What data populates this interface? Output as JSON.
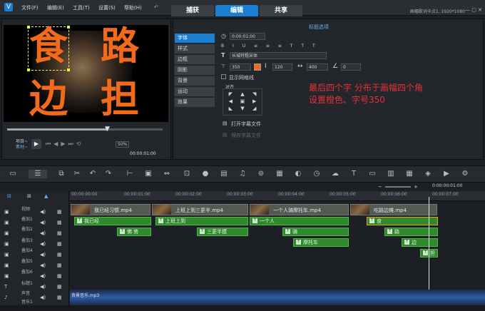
{
  "menu": {
    "file": "文件(F)",
    "edit": "编辑(E)",
    "tools": "工具(T)",
    "settings": "设置(S)",
    "help": "帮助(H)"
  },
  "tabs": {
    "capture": "捕获",
    "edit": "编辑",
    "share": "共享"
  },
  "window_info": "画幅歌词卡点1, 1920*1080",
  "preview": {
    "chars": [
      "食",
      "路",
      "边",
      "担"
    ],
    "project_label": "项目~",
    "clip_label": "素材~",
    "zoom": "50%",
    "timecode": "00:00:01:00"
  },
  "side_tabs": [
    "字体",
    "样式",
    "边框",
    "阴影",
    "背景",
    "运动",
    "效果"
  ],
  "options": {
    "title": "标题选项",
    "duration": "0:00:01:00",
    "format_buttons": [
      "B",
      "I",
      "U",
      "≡",
      "≡",
      "≡",
      "T",
      "T",
      "T"
    ],
    "font": "长城特粗宋体",
    "size": "350",
    "line_spacing": "120",
    "width": "400",
    "angle": "0",
    "show_grid": "显示网格线",
    "align_label": "对齐",
    "open_subtitle": "打开字幕文件",
    "save_subtitle": "保存字幕文件"
  },
  "annotation": {
    "line1": "最后四个字 分布于画幅四个角",
    "line2": "设置橙色、字号350"
  },
  "ruler": [
    "00:00:00:00",
    "00:00:01:00",
    "00:00:02:00",
    "00:00:03:00",
    "00:00:04:00",
    "00:00:05:00",
    "00:00:06:00",
    "00:00:07:00"
  ],
  "timeline_timecode": "0:00:00:01:00",
  "tracks": [
    "视频",
    "叠加1",
    "叠加2",
    "叠加3",
    "叠加4",
    "叠加5",
    "叠加6",
    "标题1",
    "声音",
    "音乐1"
  ],
  "video_clips": [
    "我已经习惯.mp4",
    "上班上到三更半.mp4",
    "一个人骑摩托车.mp4",
    "吃路边摊.mp4"
  ],
  "title_clips": [
    "我已经",
    "佛 势",
    "上班上到",
    "三更半摸",
    "一个人",
    "骑",
    "摩托车",
    "食",
    "路",
    "边",
    "担"
  ],
  "audio_clip": "背景音乐.mp3",
  "colors": {
    "accent": "#1a7fd0",
    "title_clip": "#2e8a2c",
    "char": "#f26a1b",
    "annotation": "#e8303a"
  }
}
